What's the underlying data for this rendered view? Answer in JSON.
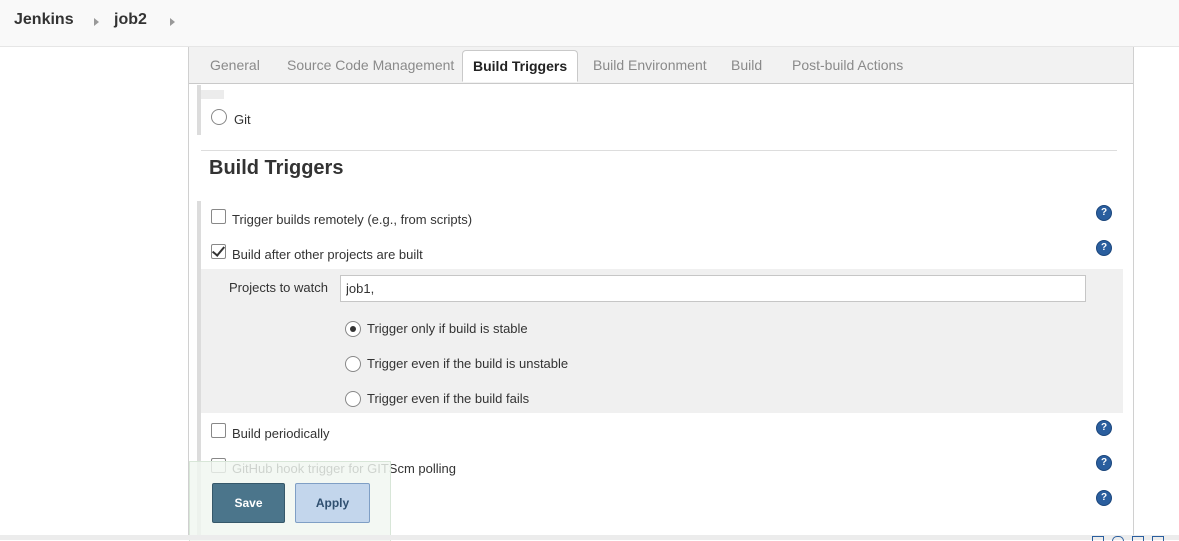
{
  "breadcrumb": {
    "root": "Jenkins",
    "job": "job2"
  },
  "tabs": [
    "General",
    "Source Code Management",
    "Build Triggers",
    "Build Environment",
    "Build",
    "Post-build Actions"
  ],
  "active_tab": "Build Triggers",
  "scm": {
    "git_label": "Git"
  },
  "section_title": "Build Triggers",
  "triggers": {
    "remote": "Trigger builds remotely (e.g., from scripts)",
    "after_other": "Build after other projects are built",
    "periodically": "Build periodically",
    "github_hook": "GitHub hook trigger for GITScm polling"
  },
  "projects_to_watch": {
    "label": "Projects to watch",
    "value": "job1,"
  },
  "trigger_options": [
    "Trigger only if build is stable",
    "Trigger even if the build is unstable",
    "Trigger even if the build fails"
  ],
  "buttons": {
    "save": "Save",
    "apply": "Apply"
  },
  "help_glyph": "?",
  "colors": {
    "save": "#4b758b",
    "apply": "#c3d6ec",
    "help": "#2a5e9e"
  }
}
